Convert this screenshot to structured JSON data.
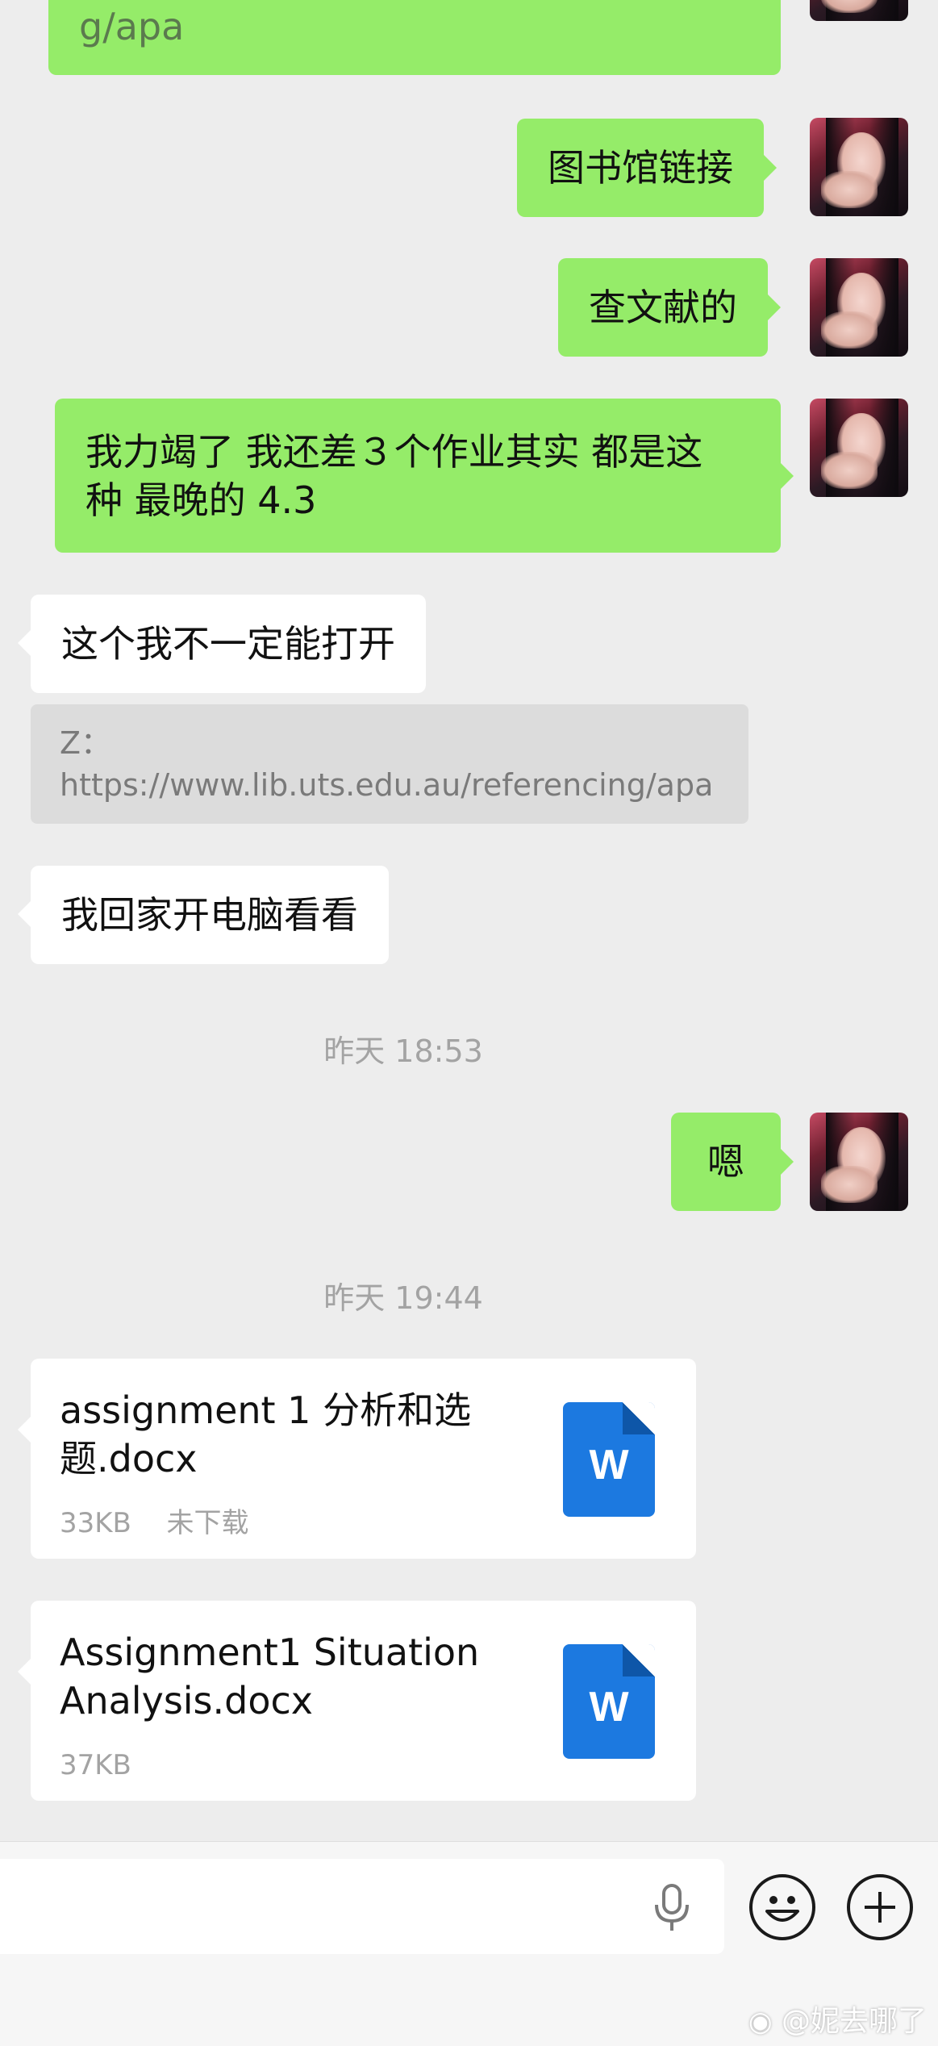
{
  "messages": {
    "top_partial": "g/apa",
    "out_1": "图书馆链接",
    "out_2": "查文献的",
    "out_3_line1": "我力竭了 我还差３个作业其实 都是这",
    "out_3_line2": "种 最晚的 4.3",
    "in_1": "这个我不一定能打开",
    "quote_line1": "Z：",
    "quote_line2": "https://www.lib.uts.edu.au/referencing/apa",
    "in_2": "我回家开电脑看看",
    "out_4": "嗯"
  },
  "timestamps": {
    "t1": "昨天 18:53",
    "t2": "昨天 19:44"
  },
  "files": [
    {
      "name_line1": "assignment 1 分析和选",
      "name_line2": "题.docx",
      "size": "33KB",
      "status": "未下载",
      "icon_letter": "W",
      "icon": "word-doc-icon"
    },
    {
      "name_line1": "Assignment1 Situation",
      "name_line2": "Analysis.docx",
      "size": "37KB",
      "status": "",
      "icon_letter": "W",
      "icon": "word-doc-icon"
    }
  ],
  "input_bar": {
    "voice_icon": "microphone-icon",
    "emoji_icon": "smiley-icon",
    "more_icon": "plus-circle-icon"
  },
  "watermark": "@妮去哪了",
  "colors": {
    "background": "#ededed",
    "outgoing_bubble": "#95ec69",
    "incoming_bubble": "#ffffff",
    "word_icon": "#1c79e0",
    "timestamp_text": "#a3a3a3"
  }
}
